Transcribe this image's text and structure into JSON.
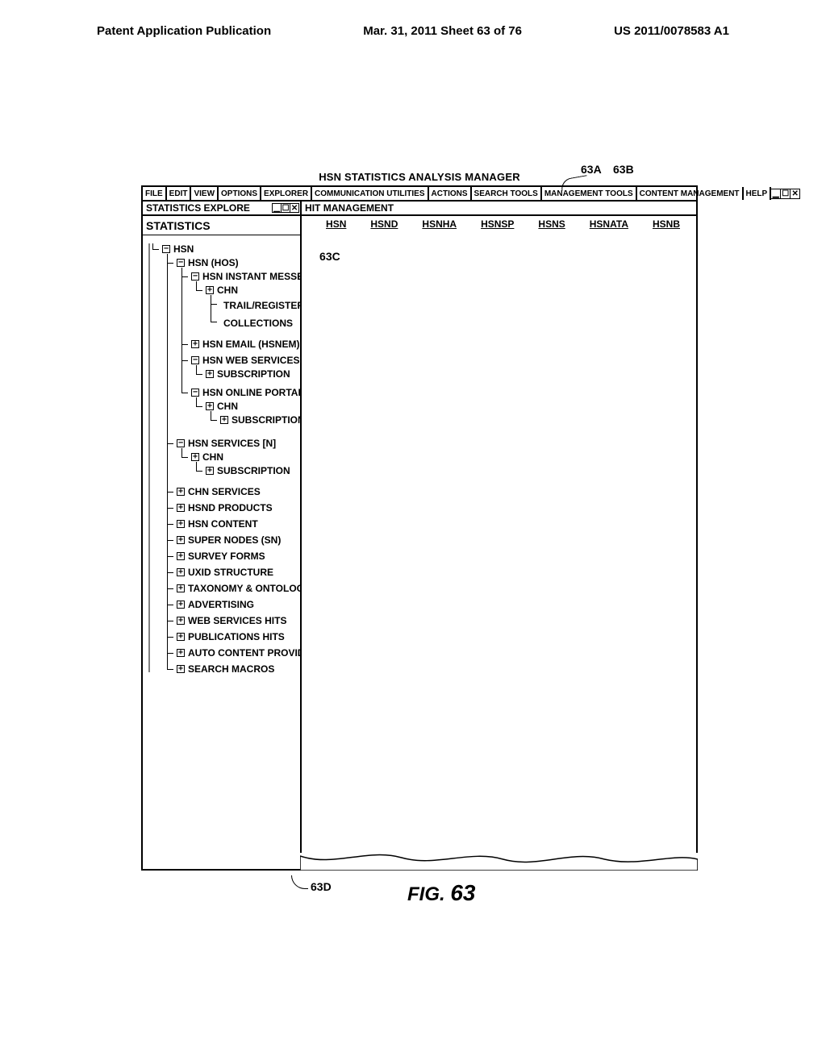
{
  "header": {
    "left": "Patent Application Publication",
    "center": "Mar. 31, 2011  Sheet 63 of 76",
    "right": "US 2011/0078583 A1"
  },
  "callouts": {
    "a": "63A",
    "b": "63B",
    "c": "63C",
    "d": "63D"
  },
  "window": {
    "title": "HSN STATISTICS ANALYSIS MANAGER",
    "menu": [
      "FILE",
      "EDIT",
      "VIEW",
      "OPTIONS",
      "EXPLORER",
      "COMMUNICATION UTILITIES",
      "ACTIONS",
      "SEARCH TOOLS",
      "MANAGEMENT TOOLS",
      "CONTENT MANAGEMENT",
      "HELP"
    ]
  },
  "left_pane": {
    "title": "STATISTICS EXPLORE",
    "subtitle": "STATISTICS"
  },
  "right_pane": {
    "title": "HIT MANAGEMENT",
    "tabs": [
      "HSN",
      "HSND",
      "HSNHA",
      "HSNSP",
      "HSNS",
      "HSNATA",
      "HSNB"
    ]
  },
  "tree": {
    "hsn": "HSN",
    "hsn_hos": "HSN (HOS)",
    "hsnm": "HSN INSTANT MESSENGER (HSNM)",
    "chn": "CHN",
    "trail": "TRAIL/REGISTERED/DOWNLOADS",
    "collections": "COLLECTIONS",
    "hsnem": "HSN EMAIL (HSNEM)",
    "hsnws": "HSN WEB SERVICES (HSNWS) [N]",
    "subscription": "SUBSCRIPTION",
    "hsnop": "HSN ONLINE PORTAL (HSNOP)",
    "hsn_services": "HSN SERVICES [N]",
    "chn_services": "CHN SERVICES",
    "hsnd_products": "HSND PRODUCTS",
    "hsn_content": "HSN CONTENT",
    "super_nodes": "SUPER NODES (SN)",
    "survey_forms": "SURVEY FORMS",
    "uxid": "UXID STRUCTURE",
    "taxonomy": "TAXONOMY & ONTOLOGY",
    "advertising": "ADVERTISING",
    "webhits": "WEB SERVICES HITS",
    "pubhits": "PUBLICATIONS HITS",
    "autohits": "AUTO CONTENT PROVIDERS HITS",
    "searchmacros": "SEARCH MACROS"
  },
  "figure": {
    "prefix": "FIG.",
    "num": "63"
  }
}
